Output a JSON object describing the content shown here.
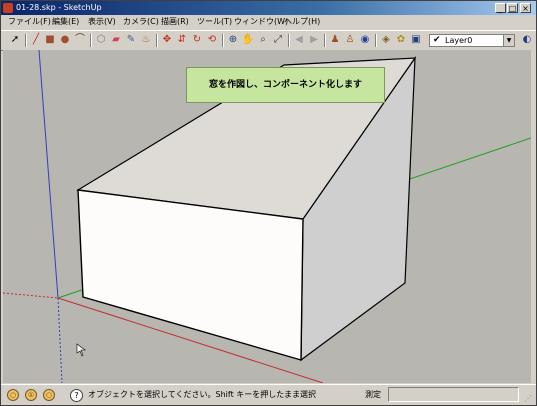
{
  "window": {
    "title": "01-28.skp - SketchUp",
    "controls": [
      "_",
      "□",
      "×"
    ]
  },
  "menubar": {
    "items": [
      {
        "label": "ファイル(F)"
      },
      {
        "label": "編集(E)"
      },
      {
        "label": "表示(V)"
      },
      {
        "label": "カメラ(C)"
      },
      {
        "label": "描画(R)"
      },
      {
        "label": "ツール(T)"
      },
      {
        "label": "ウィンドウ(W)"
      },
      {
        "label": "ヘルプ(H)"
      }
    ]
  },
  "toolbar": {
    "layer_select": {
      "check": "✔",
      "value": "Layer0",
      "arrow": "▼"
    }
  },
  "viewport": {
    "tooltip": "窓を作図し、コンポーネント化します",
    "background_color": "#b8b6b1"
  },
  "statusbar": {
    "text": "オブジェクトを選択してください。Shift キーを押したまま選択",
    "measure_label": "測定",
    "help_glyph": "?",
    "circle_glyphs": [
      "○",
      "①",
      "○"
    ],
    "grip": "⋰"
  }
}
